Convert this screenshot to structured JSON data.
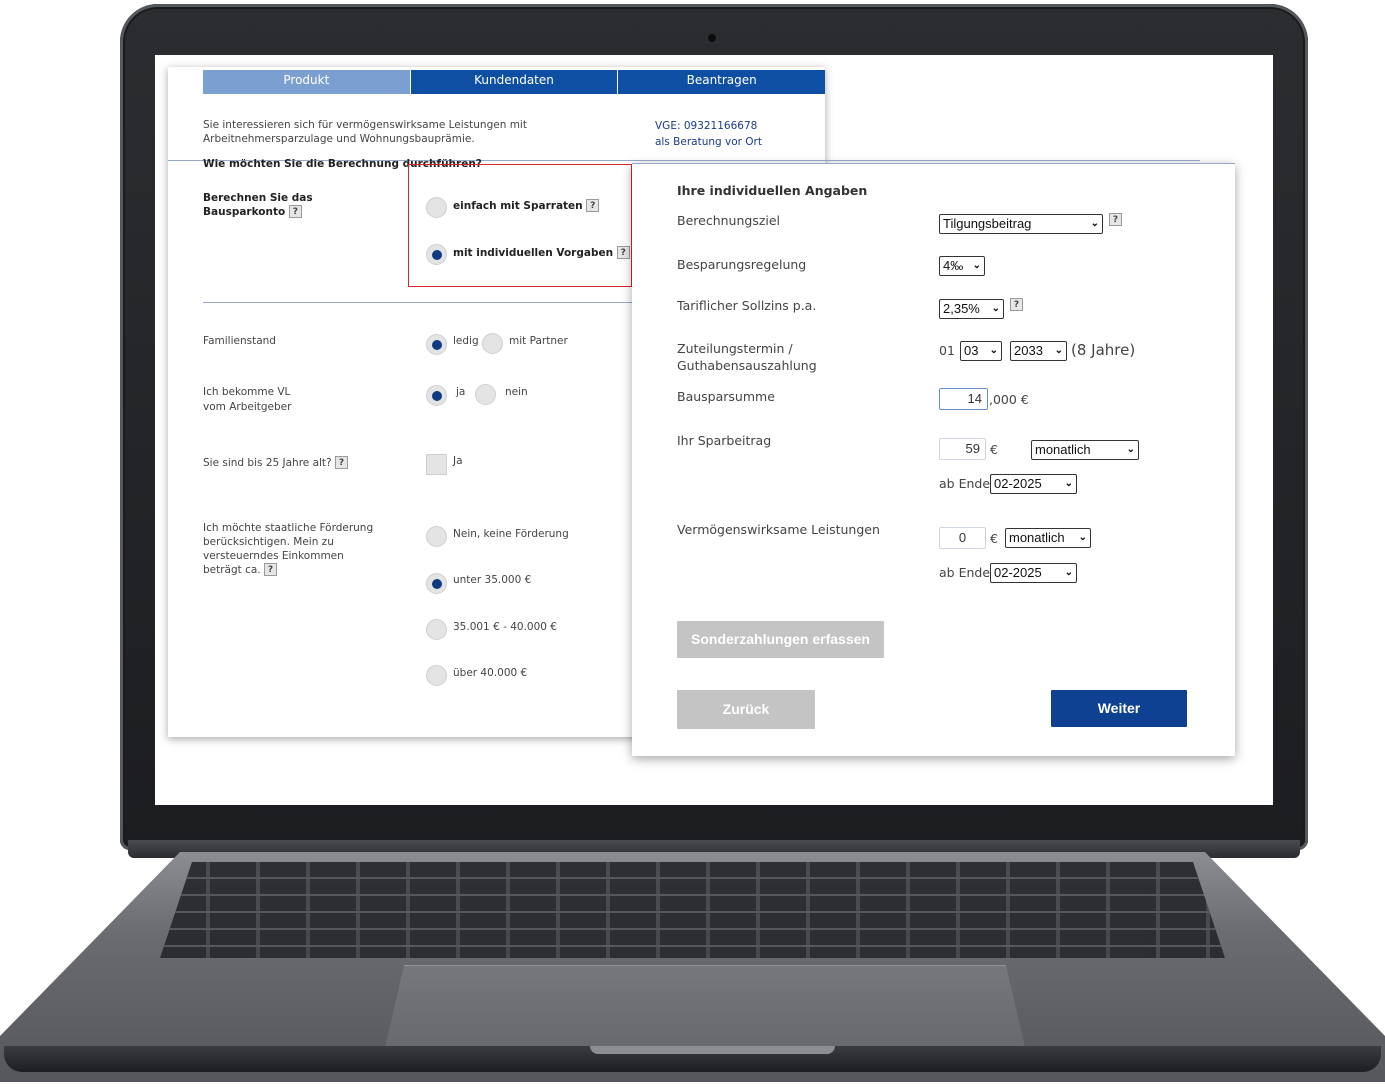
{
  "tabs": [
    "Produkt",
    "Kundendaten",
    "Beantragen"
  ],
  "back_form": {
    "intro": "Sie interessieren sich für vermögenswirksame Leistungen mit Arbeitnehmersparzulage und Wohnungsbauprämie.",
    "question": "Wie möchten Sie die Berechnung durchführen?",
    "vge": "VGE: 09321166678",
    "beratung": "als Beratung vor Ort",
    "calc_label": "Berechnen Sie das Bausparkonto",
    "opt_simple": "einfach mit Sparraten",
    "opt_individual": "mit individuellen Vorgaben",
    "familienstand_label": "Familienstand",
    "ledig": "ledig",
    "mit_partner": "mit Partner",
    "vl_label_1": "Ich bekomme VL",
    "vl_label_2": "vom Arbeitgeber",
    "ja": "ja",
    "nein": "nein",
    "age_label": "Sie sind bis 25 Jahre alt?",
    "age_check": "Ja",
    "foerderung_label": "Ich möchte staatliche Förderung berücksichtigen. Mein zu versteuerndes Einkommen beträgt ca.",
    "opt_keine": "Nein, keine Förderung",
    "opt_35": "unter 35.000 €",
    "opt_40": "35.001 € - 40.000 €",
    "opt_over": "über 40.000 €",
    "help": "?"
  },
  "front_form": {
    "title": "Ihre individuellen Angaben",
    "berechnungsziel_label": "Berechnungsziel",
    "berechnungsziel_value": "Tilgungsbeitrag",
    "besparung_label": "Besparungsregelung",
    "besparung_value": "4‰",
    "sollzins_label": "Tariflicher Sollzins p.a.",
    "sollzins_value": "2,35%",
    "zuteilung_label_1": "Zuteilungstermin /",
    "zuteilung_label_2": "Guthabensauszahlung",
    "zuteilung_day": "01",
    "zuteilung_month": "03",
    "zuteilung_year": "2033",
    "zuteilung_years": "(8 Jahre)",
    "bausparsumme_label": "Bausparsumme",
    "bausparsumme_value": "14",
    "bausparsumme_suffix": ",000 €",
    "sparbeitrag_label": "Ihr Sparbeitrag",
    "sparbeitrag_value": "59",
    "currency": "€",
    "interval_value": "monatlich",
    "ab_ende": "ab Ende",
    "ab_ende_value": "02-2025",
    "vl_label": "Vermögenswirksame Leistungen",
    "vl_value": "0",
    "vl_interval_value": "monatlich",
    "vl_ab_ende_value": "02-2025",
    "sonder_button": "Sonderzahlungen erfassen",
    "back_button": "Zurück",
    "next_button": "Weiter",
    "help": "?"
  }
}
